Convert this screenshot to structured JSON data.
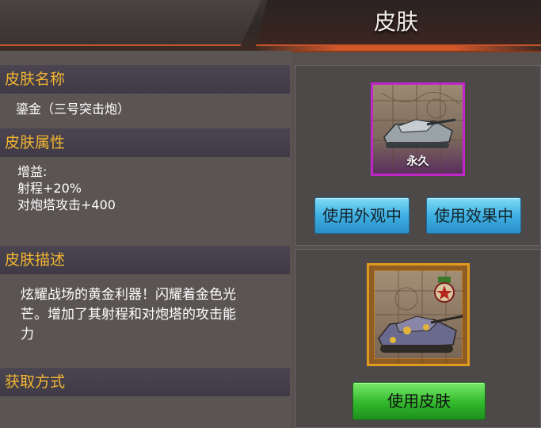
{
  "header": {
    "title": "皮肤"
  },
  "left": {
    "name_heading": "皮肤名称",
    "name_value": "鎏金（三号突击炮）",
    "attr_heading": "皮肤属性",
    "attr_lines": [
      "增益:",
      "射程+20%",
      "对炮塔攻击+400"
    ],
    "desc_heading": "皮肤描述",
    "desc_lines": [
      "炫耀战场的黄金利器！闪耀着金色光",
      "芒。增加了其射程和对炮塔的攻击能",
      "力"
    ],
    "obtain_heading": "获取方式"
  },
  "right": {
    "skin_card_label": "永久",
    "use_appearance_label": "使用外观中",
    "use_effect_label": "使用效果中",
    "use_skin_label": "使用皮肤"
  },
  "colors": {
    "heading_gold": "#f2b531",
    "skin_border": "#c126c8",
    "tank_border": "#e09a1f",
    "button_blue": "#3eb0e3",
    "button_green": "#32b92c"
  },
  "icons": [
    "map-grid-icon",
    "tank-icon",
    "rank-medal-icon"
  ]
}
